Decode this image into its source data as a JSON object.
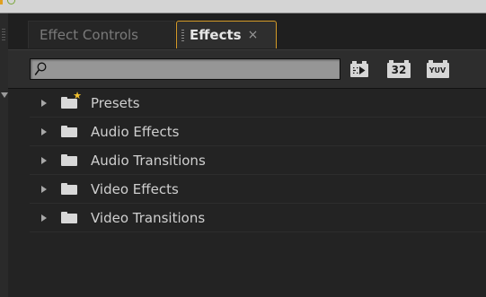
{
  "tabs": {
    "effect_controls": "Effect Controls",
    "effects": "Effects",
    "close_glyph": "×"
  },
  "toolbar": {
    "search": {
      "value": "",
      "placeholder": ""
    },
    "accelerated_icon": "accelerated-effects-icon",
    "bit32_label": "32",
    "yuv_label": "YUV"
  },
  "tree": {
    "items": [
      {
        "label": "Presets",
        "icon": "presets-folder-icon",
        "expanded": false
      },
      {
        "label": "Audio Effects",
        "icon": "folder-icon",
        "expanded": false
      },
      {
        "label": "Audio Transitions",
        "icon": "folder-icon",
        "expanded": false
      },
      {
        "label": "Video Effects",
        "icon": "folder-icon",
        "expanded": false
      },
      {
        "label": "Video Transitions",
        "icon": "folder-icon",
        "expanded": false
      }
    ]
  },
  "colors": {
    "active_tab_border": "#d49a28",
    "panel_bg": "#232323",
    "search_bg": "#969696",
    "preset_star": "#f2c12e"
  }
}
